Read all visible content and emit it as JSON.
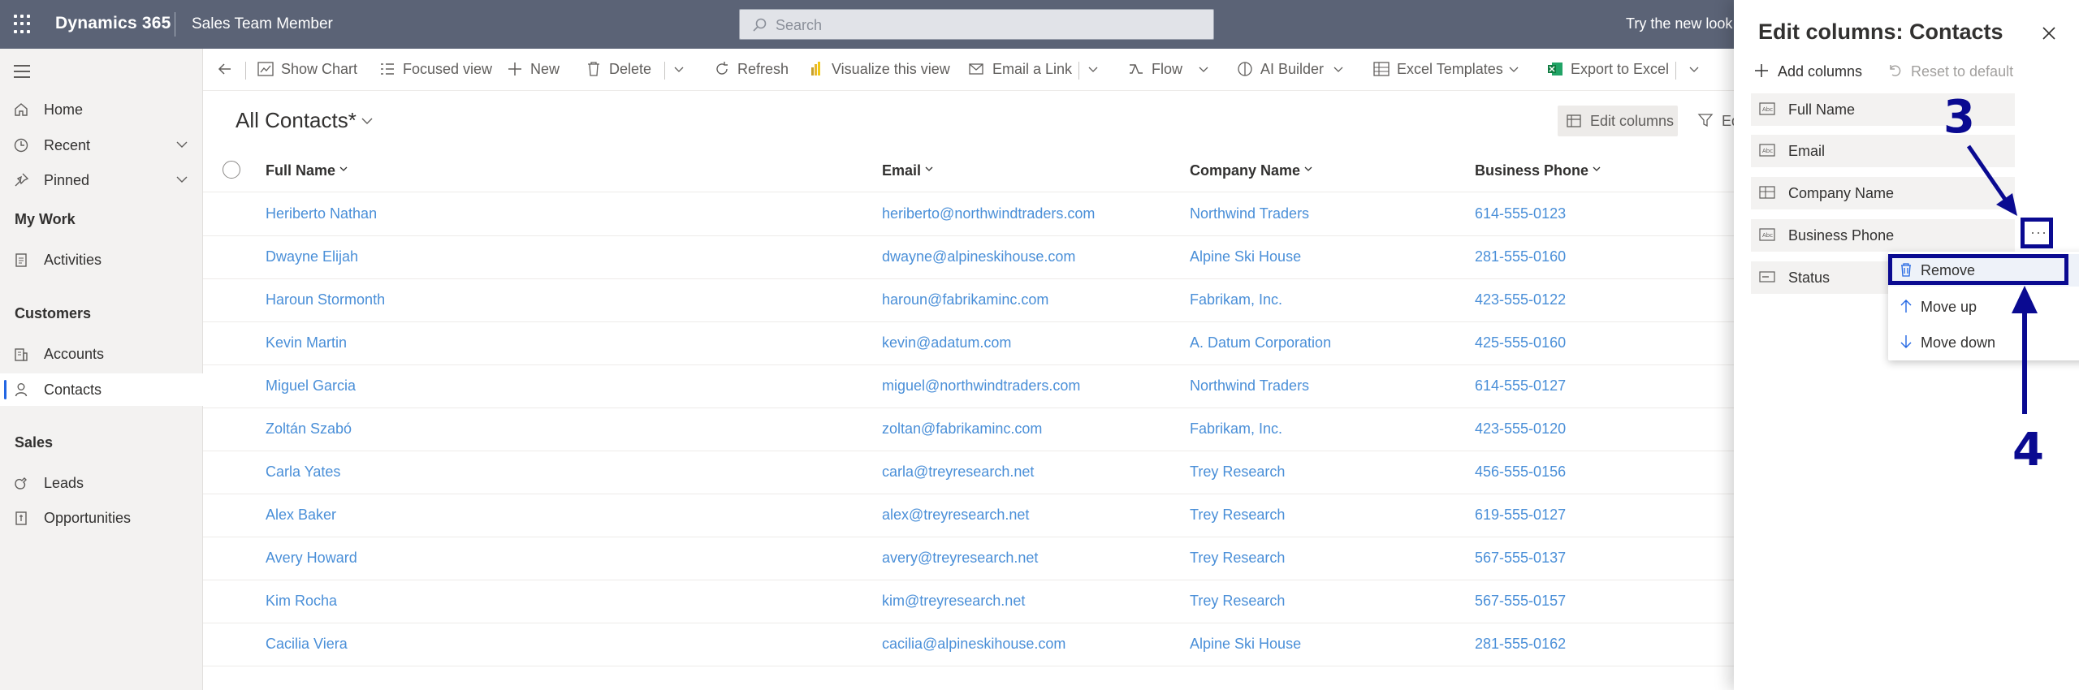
{
  "topbar": {
    "brand": "Dynamics 365",
    "app_name": "Sales Team Member",
    "search_placeholder": "Search",
    "try_new_look": "Try the new look"
  },
  "leftnav": {
    "items_top": [
      {
        "label": "Home",
        "icon": "home-icon"
      },
      {
        "label": "Recent",
        "icon": "clock-icon"
      },
      {
        "label": "Pinned",
        "icon": "pin-icon"
      }
    ],
    "my_work_heading": "My Work",
    "my_work_items": [
      {
        "label": "Activities",
        "icon": "activities-icon"
      }
    ],
    "customers_heading": "Customers",
    "customers_items": [
      {
        "label": "Accounts",
        "icon": "accounts-icon"
      },
      {
        "label": "Contacts",
        "icon": "person-icon"
      }
    ],
    "sales_heading": "Sales",
    "sales_items": [
      {
        "label": "Leads",
        "icon": "leads-icon"
      },
      {
        "label": "Opportunities",
        "icon": "opportunities-icon"
      }
    ]
  },
  "commandbar": {
    "show_chart": "Show Chart",
    "focused_view": "Focused view",
    "new": "New",
    "delete": "Delete",
    "refresh": "Refresh",
    "visualize": "Visualize this view",
    "email_link": "Email a Link",
    "flow": "Flow",
    "ai_builder": "AI Builder",
    "excel_templates": "Excel Templates",
    "export_excel": "Export to Excel"
  },
  "view": {
    "title": "All Contacts*",
    "edit_columns": "Edit columns",
    "edit_filters_partial": "Ed"
  },
  "grid": {
    "headers": [
      "Full Name",
      "Email",
      "Company Name",
      "Business Phone"
    ],
    "rows": [
      [
        "Heriberto Nathan",
        "heriberto@northwindtraders.com",
        "Northwind Traders",
        "614-555-0123"
      ],
      [
        "Dwayne Elijah",
        "dwayne@alpineskihouse.com",
        "Alpine Ski House",
        "281-555-0160"
      ],
      [
        "Haroun Stormonth",
        "haroun@fabrikaminc.com",
        "Fabrikam, Inc.",
        "423-555-0122"
      ],
      [
        "Kevin Martin",
        "kevin@adatum.com",
        "A. Datum Corporation",
        "425-555-0160"
      ],
      [
        "Miguel Garcia",
        "miguel@northwindtraders.com",
        "Northwind Traders",
        "614-555-0127"
      ],
      [
        "Zoltán Szabó",
        "zoltan@fabrikaminc.com",
        "Fabrikam, Inc.",
        "423-555-0120"
      ],
      [
        "Carla Yates",
        "carla@treyresearch.net",
        "Trey Research",
        "456-555-0156"
      ],
      [
        "Alex Baker",
        "alex@treyresearch.net",
        "Trey Research",
        "619-555-0127"
      ],
      [
        "Avery Howard",
        "avery@treyresearch.net",
        "Trey Research",
        "567-555-0137"
      ],
      [
        "Kim Rocha",
        "kim@treyresearch.net",
        "Trey Research",
        "567-555-0157"
      ],
      [
        "Cacilia Viera",
        "cacilia@alpineskihouse.com",
        "Alpine Ski House",
        "281-555-0162"
      ]
    ]
  },
  "panel": {
    "title": "Edit columns: Contacts",
    "add_columns": "Add columns",
    "reset_default": "Reset to default",
    "columns": [
      {
        "label": "Full Name",
        "icon": "text-field-icon"
      },
      {
        "label": "Email",
        "icon": "text-field-icon"
      },
      {
        "label": "Company Name",
        "icon": "lookup-field-icon"
      },
      {
        "label": "Business Phone",
        "icon": "text-field-icon"
      },
      {
        "label": "Status",
        "icon": "option-field-icon"
      }
    ],
    "more_button": "···",
    "context_menu": [
      "Remove",
      "Move up",
      "Move down"
    ]
  },
  "annotations": {
    "step3": "3",
    "step4": "4",
    "color": "#0a0a91"
  },
  "colors": {
    "topbar": "#5b6376",
    "link": "#4a8fd8",
    "annotation": "#0a0a91",
    "accent": "#2266e3"
  }
}
